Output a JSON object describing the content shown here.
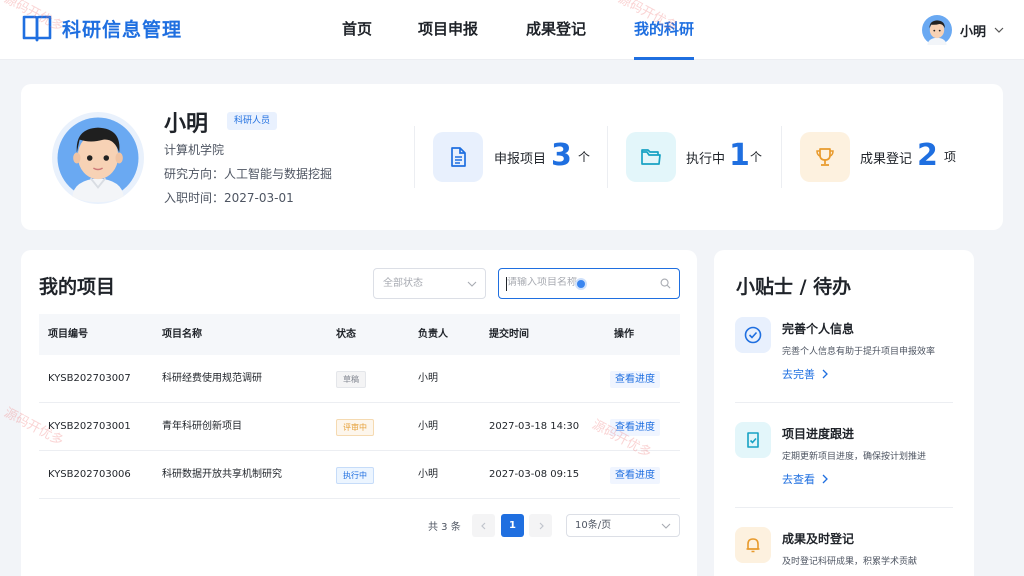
{
  "header": {
    "logo_title": "科研信息管理",
    "nav": [
      {
        "label": "首页",
        "active": false
      },
      {
        "label": "项目申报",
        "active": false
      },
      {
        "label": "成果登记",
        "active": false
      },
      {
        "label": "我的科研",
        "active": true
      }
    ],
    "user_name": "小明"
  },
  "profile": {
    "name": "小明",
    "badge": "科研人员",
    "college": "计算机学院",
    "research": "研究方向：人工智能与数据挖掘",
    "join_date": "入职时间：2027-03-01",
    "stats": [
      {
        "label": "申报项目",
        "value": "3",
        "unit": "个",
        "icon": "document-icon",
        "color": "#1f6fe0"
      },
      {
        "label": "执行中",
        "value": "1",
        "unit": "个",
        "icon": "folder-icon",
        "color": "#17a2c4"
      },
      {
        "label": "成果登记",
        "value": "2",
        "unit": "项",
        "icon": "trophy-icon",
        "color": "#e89a2c"
      }
    ]
  },
  "projects": {
    "title": "我的项目",
    "status_filter": "全部状态",
    "search_placeholder": "请输入项目名称",
    "columns": [
      "项目编号",
      "项目名称",
      "状态",
      "负责人",
      "提交时间",
      "操作"
    ],
    "rows": [
      {
        "id": "KYSB202703007",
        "name": "科研经费使用规范调研",
        "status": "草稿",
        "status_kind": "draft",
        "owner": "小明",
        "time": "",
        "action": "查看进度"
      },
      {
        "id": "KYSB202703001",
        "name": "青年科研创新项目",
        "status": "评审中",
        "status_kind": "review",
        "owner": "小明",
        "time": "2027-03-18 14:30",
        "action": "查看进度"
      },
      {
        "id": "KYSB202703006",
        "name": "科研数据开放共享机制研究",
        "status": "执行中",
        "status_kind": "doing",
        "owner": "小明",
        "time": "2027-03-08 09:15",
        "action": "查看进度"
      }
    ],
    "pagination": {
      "total": "共 3 条",
      "current": "1",
      "page_size": "10条/页"
    }
  },
  "tips": {
    "title": "小贴士 / 待办",
    "items": [
      {
        "title": "完善个人信息",
        "desc": "完善个人信息有助于提升项目申报效率",
        "link": "去完善",
        "icon": "check-circle-icon"
      },
      {
        "title": "项目进度跟进",
        "desc": "定期更新项目进度，确保按计划推进",
        "link": "去查看",
        "icon": "checklist-icon"
      },
      {
        "title": "成果及时登记",
        "desc": "及时登记科研成果，积累学术贡献",
        "link": "",
        "icon": "bell-icon"
      }
    ]
  },
  "watermark": "源码开优多",
  "colors": {
    "primary": "#1f6fe0",
    "background": "#f2f4f8"
  }
}
